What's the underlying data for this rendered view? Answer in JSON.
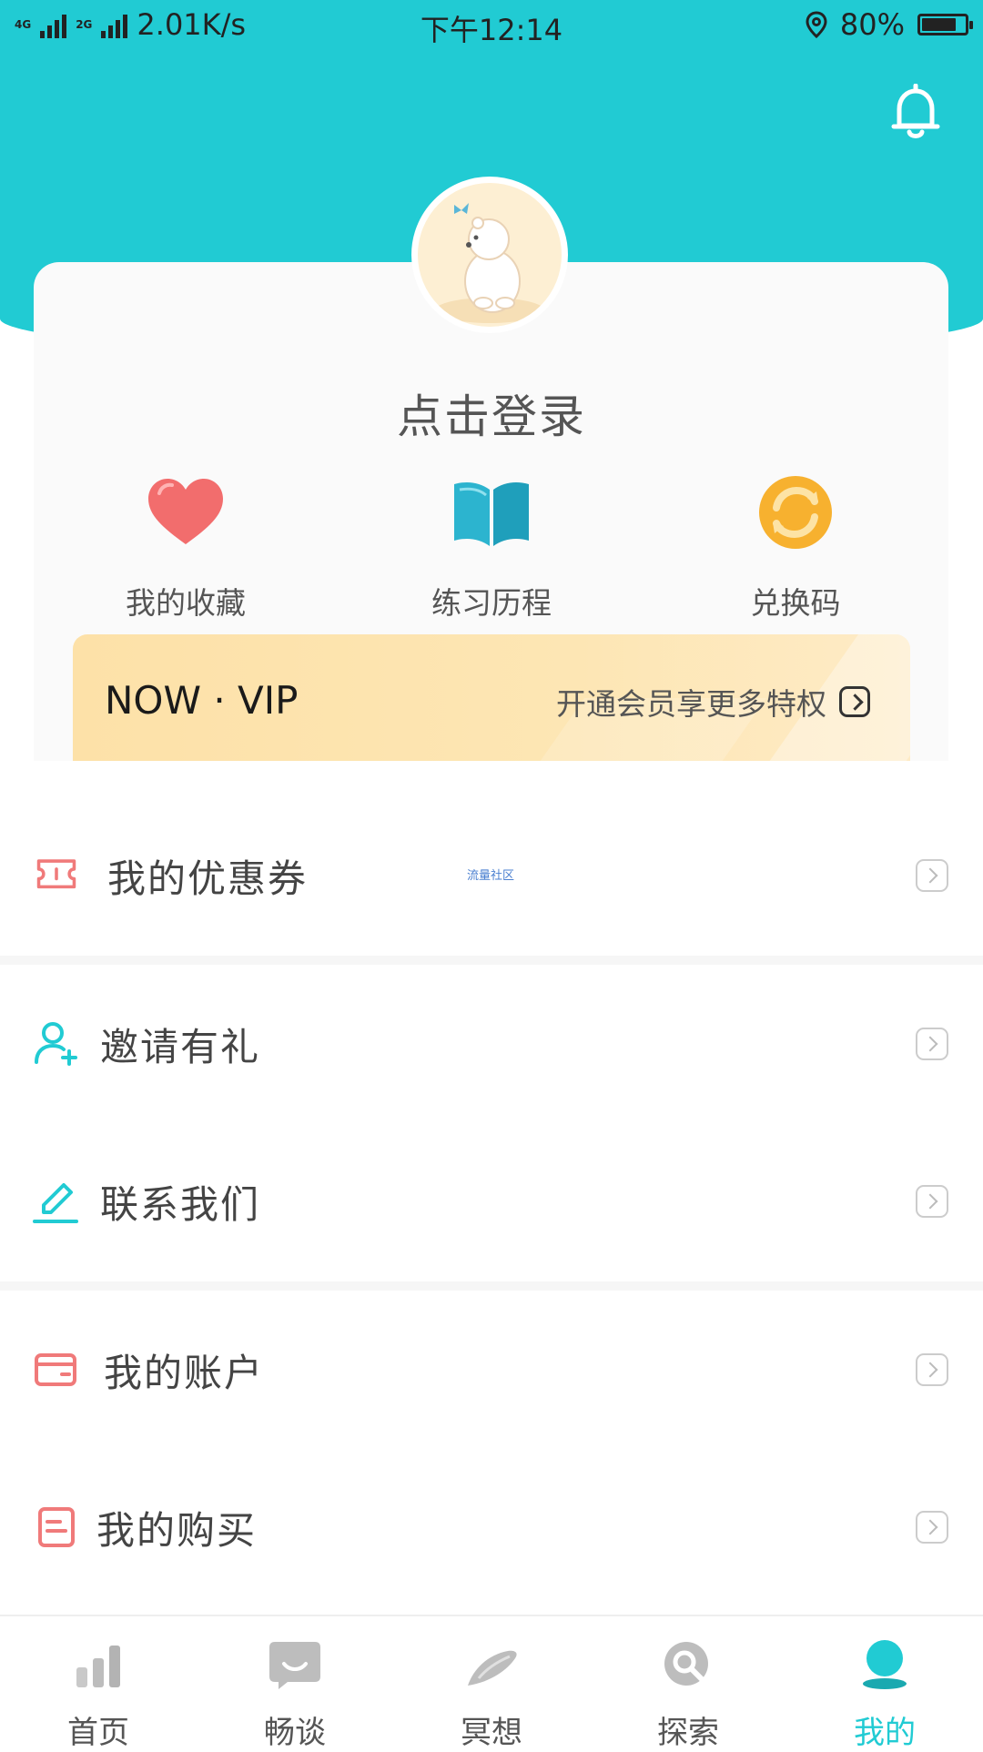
{
  "status_bar": {
    "network_label": "4G",
    "network_label2": "2G",
    "speed": "2.01K/s",
    "time": "下午12:14",
    "battery_pct": "80%",
    "battery_level": 0.8
  },
  "profile": {
    "login_text": "点击登录"
  },
  "quick_actions": [
    {
      "label": "我的收藏",
      "icon": "heart-icon"
    },
    {
      "label": "练习历程",
      "icon": "book-icon"
    },
    {
      "label": "兑换码",
      "icon": "exchange-icon"
    }
  ],
  "vip": {
    "title": "NOW · VIP",
    "promo": "开通会员享更多特权"
  },
  "watermark": "流量社区",
  "menu": [
    {
      "label": "我的优惠券",
      "icon": "coupon-icon"
    },
    {
      "label": "邀请有礼",
      "icon": "invite-user-icon"
    },
    {
      "label": "联系我们",
      "icon": "pen-icon"
    },
    {
      "label": "我的账户",
      "icon": "wallet-icon"
    },
    {
      "label": "我的购买",
      "icon": "purchase-doc-icon"
    }
  ],
  "tabs": [
    {
      "label": "首页",
      "icon": "home-bars-icon"
    },
    {
      "label": "畅谈",
      "icon": "chat-icon"
    },
    {
      "label": "冥想",
      "icon": "meditation-icon"
    },
    {
      "label": "探索",
      "icon": "explore-search-icon"
    },
    {
      "label": "我的",
      "icon": "profile-icon",
      "active": true
    }
  ],
  "colors": {
    "accent": "#21cbd3",
    "icon_red": "#f07a7a",
    "vip_bg": "#fde3ad"
  }
}
